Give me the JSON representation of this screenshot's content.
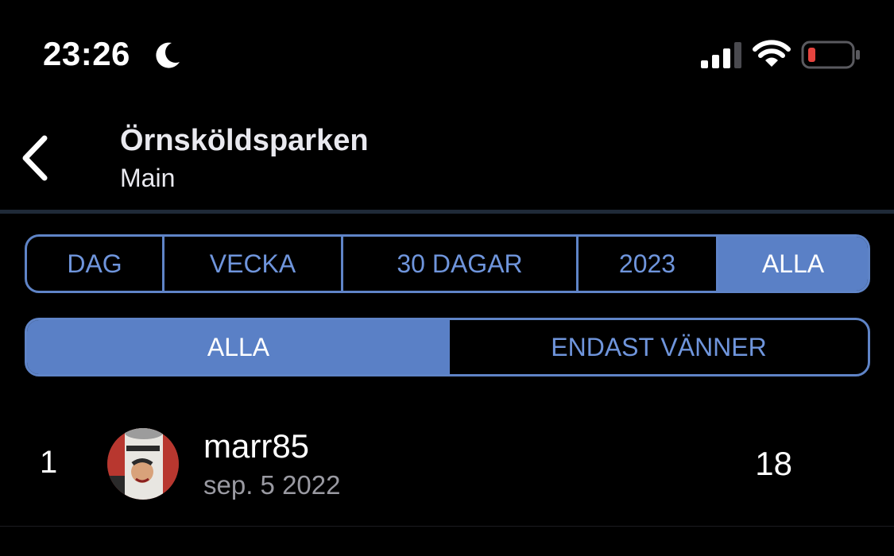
{
  "status_bar": {
    "time": "23:26",
    "icons": [
      "moon-icon",
      "cellular-signal-icon",
      "wifi-icon",
      "battery-low-icon"
    ],
    "battery_color": "#e5443f"
  },
  "header": {
    "title": "Örnsköldsparken",
    "subtitle": "Main",
    "back_icon": "chevron-left-icon"
  },
  "period_tabs": {
    "items": [
      "DAG",
      "VECKA",
      "30 DAGAR",
      "2023",
      "ALLA"
    ],
    "selected": "ALLA"
  },
  "audience_tabs": {
    "items": [
      "ALLA",
      "ENDAST VÄNNER"
    ],
    "selected": "ALLA"
  },
  "leaderboard": [
    {
      "rank": "1",
      "username": "marr85",
      "date": "sep. 5 2022",
      "score": "18"
    }
  ],
  "colors": {
    "accent": "#5a80c6",
    "accent_text": "#6f95dc",
    "background": "#000000",
    "secondary_text": "#9a9aa2"
  }
}
